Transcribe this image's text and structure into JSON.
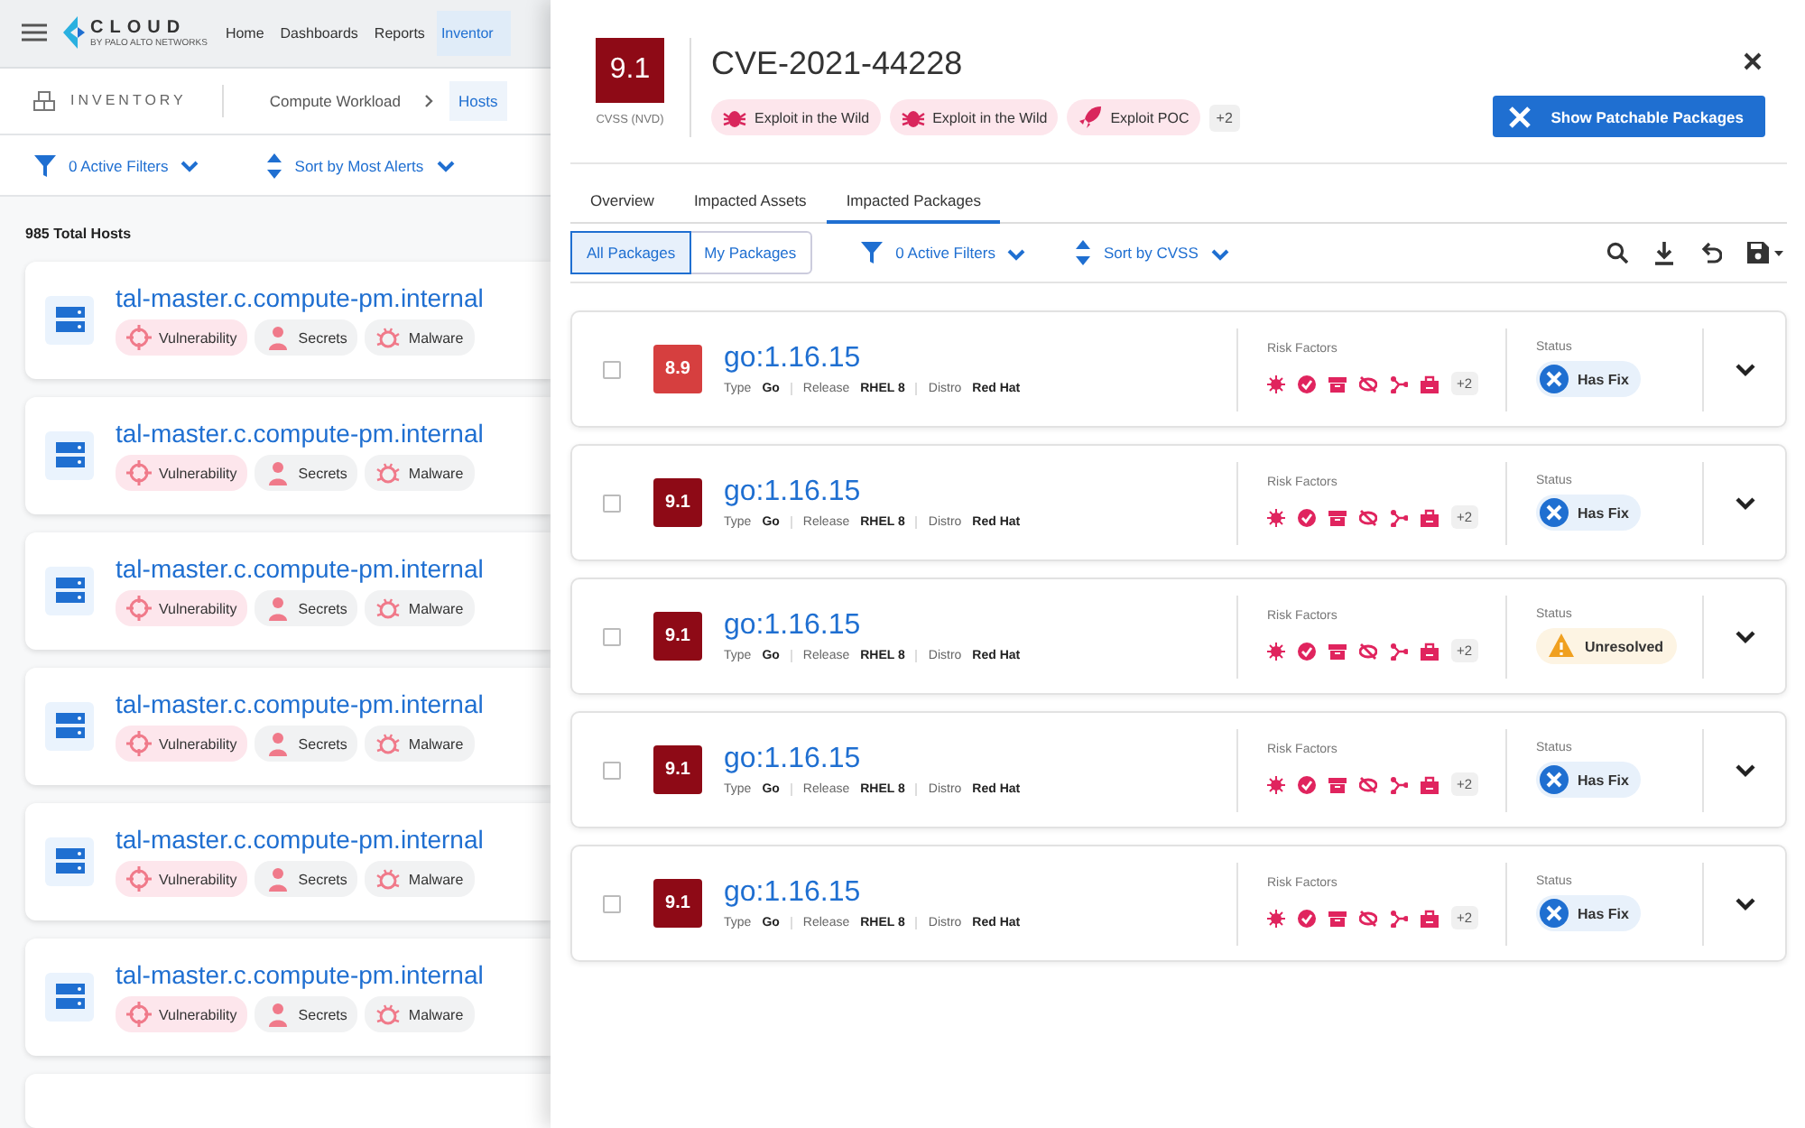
{
  "topbar": {
    "logo": "CLOUD",
    "logo_sub": "BY PALO ALTO NETWORKS",
    "nav": [
      {
        "label": "Home",
        "selected": false
      },
      {
        "label": "Dashboards",
        "selected": false
      },
      {
        "label": "Reports",
        "selected": false
      },
      {
        "label": "Inventor",
        "selected": true
      }
    ]
  },
  "breadcrumb": {
    "section": "INVENTORY",
    "items": [
      {
        "label": "Compute Workload",
        "selected": false
      },
      {
        "label": "Hosts",
        "selected": true
      }
    ]
  },
  "list_toolbar": {
    "filters": "0 Active Filters",
    "sort": "Sort by Most Alerts"
  },
  "total": "985 Total Hosts",
  "hosts": [
    {
      "name": "tal-master.c.compute-pm.internal",
      "tags": [
        {
          "kind": "vulnerability",
          "label": "Vulnerability"
        },
        {
          "kind": "secrets",
          "label": "Secrets"
        },
        {
          "kind": "malware",
          "label": "Malware"
        }
      ]
    },
    {
      "name": "tal-master.c.compute-pm.internal",
      "tags": [
        {
          "kind": "vulnerability",
          "label": "Vulnerability"
        },
        {
          "kind": "secrets",
          "label": "Secrets"
        },
        {
          "kind": "malware",
          "label": "Malware"
        }
      ]
    },
    {
      "name": "tal-master.c.compute-pm.internal",
      "tags": [
        {
          "kind": "vulnerability",
          "label": "Vulnerability"
        },
        {
          "kind": "secrets",
          "label": "Secrets"
        },
        {
          "kind": "malware",
          "label": "Malware"
        }
      ]
    },
    {
      "name": "tal-master.c.compute-pm.internal",
      "tags": [
        {
          "kind": "vulnerability",
          "label": "Vulnerability"
        },
        {
          "kind": "secrets",
          "label": "Secrets"
        },
        {
          "kind": "malware",
          "label": "Malware"
        }
      ]
    },
    {
      "name": "tal-master.c.compute-pm.internal",
      "tags": [
        {
          "kind": "vulnerability",
          "label": "Vulnerability"
        },
        {
          "kind": "secrets",
          "label": "Secrets"
        },
        {
          "kind": "malware",
          "label": "Malware"
        }
      ]
    },
    {
      "name": "tal-master.c.compute-pm.internal",
      "tags": [
        {
          "kind": "vulnerability",
          "label": "Vulnerability"
        },
        {
          "kind": "secrets",
          "label": "Secrets"
        },
        {
          "kind": "malware",
          "label": "Malware"
        }
      ]
    }
  ],
  "drawer": {
    "score": "9.1",
    "score_label": "CVSS (NVD)",
    "title": "CVE-2021-44228",
    "chips": [
      {
        "kind": "bug",
        "label": "Exploit in the Wild"
      },
      {
        "kind": "bug",
        "label": "Exploit in the Wild"
      },
      {
        "kind": "rocket",
        "label": "Exploit POC"
      }
    ],
    "more": "+2",
    "action": "Show Patchable Packages",
    "tabs": [
      {
        "label": "Overview",
        "selected": false
      },
      {
        "label": "Impacted Assets",
        "selected": false
      },
      {
        "label": "Impacted Packages",
        "selected": true
      }
    ],
    "segments": [
      {
        "label": "All Packages",
        "selected": true
      },
      {
        "label": "My Packages",
        "selected": false
      }
    ],
    "filters": "0 Active Filters",
    "sort": "Sort by CVSS",
    "packages": [
      {
        "score": "8.9",
        "color": "#d63f3f",
        "name": "go:1.16.15",
        "checked": false,
        "meta": [
          {
            "label": "Type",
            "value": "Go"
          },
          {
            "label": "Release",
            "value": "RHEL 8"
          },
          {
            "label": "Distro",
            "value": "Red Hat"
          }
        ],
        "risk_label": "Risk Factors",
        "risk_more": "+2",
        "status_label": "Status",
        "status": {
          "kind": "fix",
          "label": "Has Fix"
        }
      },
      {
        "score": "9.1",
        "color": "#8e0a16",
        "name": "go:1.16.15",
        "checked": false,
        "meta": [
          {
            "label": "Type",
            "value": "Go"
          },
          {
            "label": "Release",
            "value": "RHEL 8"
          },
          {
            "label": "Distro",
            "value": "Red Hat"
          }
        ],
        "risk_label": "Risk Factors",
        "risk_more": "+2",
        "status_label": "Status",
        "status": {
          "kind": "fix",
          "label": "Has Fix"
        }
      },
      {
        "score": "9.1",
        "color": "#8e0a16",
        "name": "go:1.16.15",
        "checked": false,
        "meta": [
          {
            "label": "Type",
            "value": "Go"
          },
          {
            "label": "Release",
            "value": "RHEL 8"
          },
          {
            "label": "Distro",
            "value": "Red Hat"
          }
        ],
        "risk_label": "Risk Factors",
        "risk_more": "+2",
        "status_label": "Status",
        "status": {
          "kind": "unresolved",
          "label": "Unresolved"
        }
      },
      {
        "score": "9.1",
        "color": "#8e0a16",
        "name": "go:1.16.15",
        "checked": false,
        "meta": [
          {
            "label": "Type",
            "value": "Go"
          },
          {
            "label": "Release",
            "value": "RHEL 8"
          },
          {
            "label": "Distro",
            "value": "Red Hat"
          }
        ],
        "risk_label": "Risk Factors",
        "risk_more": "+2",
        "status_label": "Status",
        "status": {
          "kind": "fix",
          "label": "Has Fix"
        }
      },
      {
        "score": "9.1",
        "color": "#8e0a16",
        "name": "go:1.16.15",
        "checked": false,
        "meta": [
          {
            "label": "Type",
            "value": "Go"
          },
          {
            "label": "Release",
            "value": "RHEL 8"
          },
          {
            "label": "Distro",
            "value": "Red Hat"
          }
        ],
        "risk_label": "Risk Factors",
        "risk_more": "+2",
        "status_label": "Status",
        "status": {
          "kind": "fix",
          "label": "Has Fix"
        }
      }
    ]
  }
}
